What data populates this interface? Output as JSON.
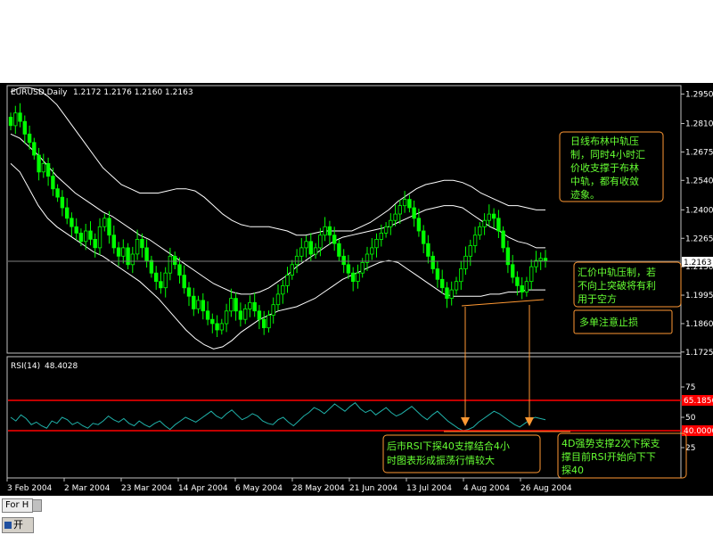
{
  "header": {
    "symbol": "EURUSD,Daily",
    "ohlc": "1.2172 1.2176 1.2160 1.2163",
    "rsi_label": "RSI(14)",
    "rsi_value": "48.4028"
  },
  "price_axis": {
    "ticks": [
      "1.2950",
      "1.2810",
      "1.2675",
      "1.2540",
      "1.2400",
      "1.2265",
      "1.2130",
      "1.1995",
      "1.1860",
      "1.1725"
    ],
    "current_price": "1.2163"
  },
  "rsi_axis": {
    "ticks": [
      "75",
      "50",
      "25"
    ],
    "upper_level": "65.1856",
    "lower_level": "40.0000"
  },
  "x_axis": {
    "ticks": [
      "3 Feb 2004",
      "2 Mar 2004",
      "23 Mar 2004",
      "14 Apr 2004",
      "6 May 2004",
      "28 May 2004",
      "21 Jun 2004",
      "13 Jul 2004",
      "4 Aug 2004",
      "26 Aug 2004"
    ]
  },
  "annotations": {
    "daily_bollinger": [
      "日线布林中轨压",
      "制，同时4小时汇",
      "价收支撑于布林",
      "中轨，都有收敛",
      "迹象。"
    ],
    "price_resistance": [
      "汇价中轨压制，若",
      "不向上突破将有利",
      "用于空方"
    ],
    "long_stop": [
      "多单注意止损"
    ],
    "rsi_support": [
      "后市RSI下探40支撑结合4小",
      "时图表形成振荡行情较大"
    ],
    "rsi_4d": [
      "4D强势支撑2次下探支",
      "撑目前RSI开始向下下",
      "探40"
    ]
  },
  "bottom": {
    "tab_label": "For H",
    "start_label": "开"
  },
  "chart_data": [
    {
      "type": "candlestick",
      "title": "EURUSD,Daily",
      "x_ticks": [
        "3 Feb 2004",
        "2 Mar 2004",
        "23 Mar 2004",
        "14 Apr 2004",
        "6 May 2004",
        "28 May 2004",
        "21 Jun 2004",
        "13 Jul 2004",
        "4 Aug 2004",
        "26 Aug 2004"
      ],
      "ylim": [
        1.172,
        1.299
      ],
      "close_series": [
        1.28,
        1.286,
        1.282,
        1.276,
        1.272,
        1.266,
        1.258,
        1.262,
        1.256,
        1.25,
        1.246,
        1.241,
        1.236,
        1.232,
        1.229,
        1.225,
        1.23,
        1.226,
        1.222,
        1.232,
        1.236,
        1.228,
        1.222,
        1.218,
        1.222,
        1.214,
        1.219,
        1.226,
        1.222,
        1.216,
        1.21,
        1.206,
        1.203,
        1.21,
        1.218,
        1.214,
        1.209,
        1.203,
        1.199,
        1.193,
        1.197,
        1.192,
        1.188,
        1.186,
        1.183,
        1.186,
        1.192,
        1.198,
        1.192,
        1.188,
        1.193,
        1.196,
        1.192,
        1.188,
        1.184,
        1.19,
        1.195,
        1.2,
        1.204,
        1.209,
        1.214,
        1.218,
        1.222,
        1.225,
        1.219,
        1.222,
        1.228,
        1.232,
        1.228,
        1.224,
        1.218,
        1.214,
        1.21,
        1.206,
        1.21,
        1.215,
        1.219,
        1.222,
        1.226,
        1.229,
        1.232,
        1.235,
        1.238,
        1.242,
        1.245,
        1.241,
        1.236,
        1.23,
        1.224,
        1.218,
        1.212,
        1.207,
        1.203,
        1.198,
        1.202,
        1.206,
        1.212,
        1.218,
        1.223,
        1.228,
        1.232,
        1.235,
        1.238,
        1.236,
        1.23,
        1.222,
        1.214,
        1.208,
        1.204,
        1.201,
        1.206,
        1.213,
        1.216,
        1.217,
        1.216
      ],
      "bollinger_upper": [
        1.296,
        1.298,
        1.298,
        1.297,
        1.294,
        1.29,
        1.284,
        1.278,
        1.272,
        1.266,
        1.26,
        1.256,
        1.252,
        1.25,
        1.248,
        1.248,
        1.248,
        1.249,
        1.25,
        1.25,
        1.249,
        1.246,
        1.242,
        1.238,
        1.235,
        1.233,
        1.232,
        1.232,
        1.232,
        1.231,
        1.23,
        1.228,
        1.228,
        1.229,
        1.23,
        1.23,
        1.23,
        1.23,
        1.232,
        1.234,
        1.237,
        1.24,
        1.244,
        1.247,
        1.25,
        1.252,
        1.253,
        1.254,
        1.254,
        1.253,
        1.251,
        1.248,
        1.246,
        1.244,
        1.242,
        1.242,
        1.241,
        1.24,
        1.24
      ],
      "bollinger_middle": [
        1.276,
        1.274,
        1.27,
        1.266,
        1.261,
        1.256,
        1.252,
        1.248,
        1.245,
        1.242,
        1.239,
        1.237,
        1.234,
        1.231,
        1.228,
        1.226,
        1.223,
        1.22,
        1.217,
        1.214,
        1.211,
        1.208,
        1.205,
        1.203,
        1.201,
        1.2,
        1.2,
        1.201,
        1.203,
        1.206,
        1.209,
        1.213,
        1.216,
        1.219,
        1.222,
        1.225,
        1.227,
        1.228,
        1.229,
        1.23,
        1.231,
        1.232,
        1.234,
        1.236,
        1.238,
        1.24,
        1.241,
        1.242,
        1.242,
        1.241,
        1.238,
        1.235,
        1.232,
        1.23,
        1.227,
        1.225,
        1.224,
        1.222,
        1.222
      ],
      "bollinger_lower": [
        1.262,
        1.258,
        1.25,
        1.242,
        1.236,
        1.232,
        1.229,
        1.226,
        1.223,
        1.22,
        1.218,
        1.215,
        1.212,
        1.209,
        1.206,
        1.202,
        1.198,
        1.193,
        1.188,
        1.183,
        1.179,
        1.176,
        1.174,
        1.175,
        1.178,
        1.182,
        1.185,
        1.188,
        1.19,
        1.192,
        1.193,
        1.194,
        1.196,
        1.198,
        1.201,
        1.204,
        1.207,
        1.209,
        1.211,
        1.213,
        1.215,
        1.216,
        1.215,
        1.212,
        1.209,
        1.206,
        1.203,
        1.2,
        1.199,
        1.199,
        1.199,
        1.199,
        1.2,
        1.2,
        1.201,
        1.201,
        1.202,
        1.202,
        1.202
      ],
      "current_price": 1.2163
    },
    {
      "type": "line",
      "title": "RSI(14)",
      "ylim": [
        0,
        100
      ],
      "levels": [
        65.1856,
        40
      ],
      "values": [
        50,
        47,
        52,
        49,
        44,
        46,
        43,
        41,
        47,
        45,
        50,
        48,
        44,
        46,
        43,
        41,
        45,
        44,
        47,
        51,
        48,
        46,
        49,
        45,
        43,
        47,
        44,
        42,
        45,
        47,
        43,
        40,
        44,
        47,
        50,
        48,
        46,
        49,
        52,
        55,
        51,
        49,
        53,
        56,
        52,
        48,
        50,
        53,
        51,
        47,
        45,
        44,
        48,
        50,
        46,
        43,
        47,
        51,
        54,
        58,
        56,
        53,
        57,
        61,
        58,
        55,
        59,
        62,
        57,
        54,
        56,
        52,
        55,
        58,
        54,
        51,
        53,
        56,
        59,
        55,
        51,
        48,
        52,
        55,
        51,
        47,
        44,
        41,
        39,
        40,
        42,
        46,
        49,
        52,
        55,
        53,
        50,
        47,
        44,
        42,
        45,
        48,
        50,
        49,
        48
      ]
    }
  ]
}
